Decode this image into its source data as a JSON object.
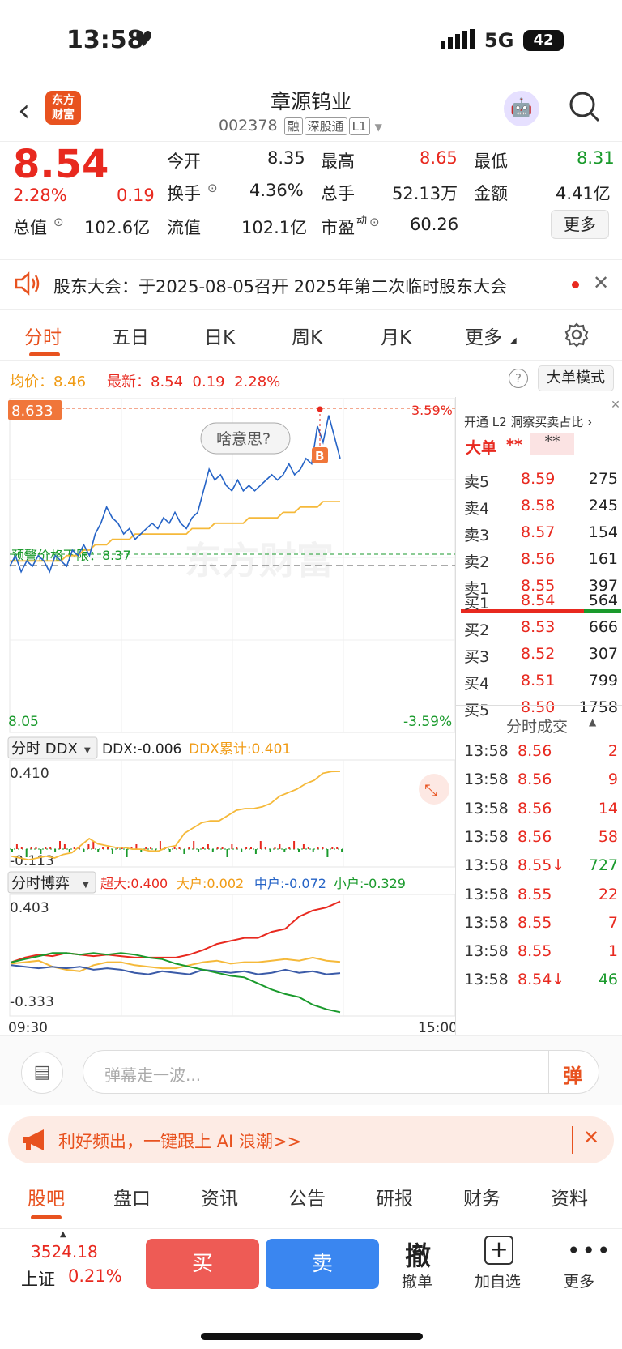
{
  "status": {
    "time": "13:58",
    "network": "5G",
    "battery": "42"
  },
  "header": {
    "logo": "东方财富",
    "logo_line1": "东方",
    "logo_line2": "财富",
    "title": "章源钨业",
    "code": "002378",
    "tags": [
      "融",
      "深股通",
      "L1"
    ]
  },
  "quote": {
    "price": "8.54",
    "change_pct": "2.28%",
    "change": "0.19",
    "open_label": "今开",
    "open": "8.35",
    "high_label": "最高",
    "high": "8.65",
    "low_label": "最低",
    "low": "8.31",
    "turnover_label": "换手",
    "turnover": "4.36%",
    "volume_label": "总手",
    "volume": "52.13万",
    "amount_label": "金额",
    "amount": "4.41亿",
    "mktcap_label": "总值",
    "mktcap": "102.6亿",
    "float_label": "流值",
    "float": "102.1亿",
    "pe_label": "市盈",
    "pe_sup": "动",
    "pe": "60.26",
    "more": "更多"
  },
  "notice": {
    "text": "股东大会：于2025-08-05召开 2025年第二次临时股东大会"
  },
  "tabs": [
    "分时",
    "五日",
    "日K",
    "周K",
    "月K",
    "更多"
  ],
  "infobar": {
    "avg_label": "均价：",
    "avg": "8.46",
    "latest_label": "最新：",
    "latest": "8.54",
    "change": "0.19",
    "pct": "2.28%",
    "big_order_mode": "大单模式"
  },
  "chart_data": [
    {
      "type": "line",
      "title": "",
      "y_top": "8.633",
      "y_bottom": "8.05",
      "pct_top": "3.59%",
      "pct_bottom": "-3.59%",
      "ylim": [
        8.05,
        8.633
      ],
      "limit_label": "预警价格下限：8.37",
      "watermark": "东方财富",
      "tooltip": "啥意思?",
      "marker": "B",
      "x_start": "09:30",
      "x_end": "15:00",
      "series": [
        {
          "values": [
            8.34,
            8.36,
            8.33,
            8.35,
            8.34,
            8.36,
            8.35,
            8.33,
            8.36,
            8.35,
            8.34,
            8.37,
            8.36,
            8.38,
            8.36,
            8.4,
            8.42,
            8.45,
            8.43,
            8.42,
            8.4,
            8.41,
            8.39,
            8.4,
            8.41,
            8.42,
            8.41,
            8.43,
            8.42,
            8.44,
            8.42,
            8.41,
            8.43,
            8.44,
            8.48,
            8.52,
            8.5,
            8.51,
            8.49,
            8.48,
            8.5,
            8.48,
            8.49,
            8.48,
            8.49,
            8.5,
            8.51,
            8.5,
            8.51,
            8.53,
            8.51,
            8.52,
            8.54,
            8.53,
            8.6,
            8.57,
            8.62,
            8.58,
            8.54
          ]
        },
        {
          "values": [
            8.35,
            8.35,
            8.35,
            8.35,
            8.35,
            8.35,
            8.35,
            8.35,
            8.35,
            8.35,
            8.36,
            8.36,
            8.36,
            8.37,
            8.37,
            8.38,
            8.38,
            8.38,
            8.39,
            8.39,
            8.39,
            8.39,
            8.4,
            8.4,
            8.4,
            8.4,
            8.4,
            8.4,
            8.4,
            8.4,
            8.4,
            8.4,
            8.41,
            8.41,
            8.41,
            8.41,
            8.42,
            8.42,
            8.42,
            8.42,
            8.42,
            8.42,
            8.43,
            8.43,
            8.43,
            8.43,
            8.43,
            8.43,
            8.44,
            8.44,
            8.44,
            8.45,
            8.45,
            8.45,
            8.45,
            8.46,
            8.46,
            8.46,
            8.46
          ]
        }
      ]
    },
    {
      "type": "line",
      "title": "分时 DDX",
      "ddx_label": "DDX:-0.006",
      "ddx_sum_label": "DDX累计:0.401",
      "y_top": "0.410",
      "y_bottom": "-0.113",
      "ylim": [
        -0.113,
        0.41
      ],
      "series": [
        {
          "values": [
            -0.08,
            -0.09,
            -0.1,
            -0.09,
            -0.08,
            -0.09,
            -0.07,
            -0.06,
            -0.02,
            0.02,
            -0.01,
            -0.02,
            -0.03,
            -0.03,
            -0.04,
            -0.04,
            -0.05,
            -0.05,
            -0.03,
            -0.02,
            0.05,
            0.08,
            0.11,
            0.12,
            0.12,
            0.15,
            0.18,
            0.19,
            0.19,
            0.2,
            0.22,
            0.26,
            0.28,
            0.3,
            0.33,
            0.35,
            0.39,
            0.4,
            0.401
          ]
        }
      ]
    },
    {
      "type": "line",
      "title": "分时博弈",
      "labels": [
        "超大:0.400",
        "大户:0.002",
        "中户:-0.072",
        "小户:-0.329"
      ],
      "y_top": "0.403",
      "y_bottom": "-0.333",
      "ylim": [
        -0.333,
        0.403
      ],
      "series": [
        {
          "values": [
            0.0,
            0.03,
            0.05,
            0.04,
            0.06,
            0.05,
            0.04,
            0.05,
            0.04,
            0.03,
            0.03,
            0.03,
            0.03,
            0.05,
            0.08,
            0.12,
            0.14,
            0.16,
            0.16,
            0.2,
            0.22,
            0.3,
            0.34,
            0.36,
            0.4
          ]
        },
        {
          "values": [
            -0.01,
            0.0,
            0.01,
            -0.03,
            -0.05,
            -0.06,
            -0.02,
            0.0,
            0.0,
            -0.02,
            -0.03,
            -0.04,
            -0.04,
            -0.02,
            0.0,
            0.01,
            -0.01,
            0.0,
            0.0,
            0.01,
            0.02,
            0.01,
            0.03,
            0.01,
            0.002
          ]
        },
        {
          "values": [
            -0.02,
            -0.03,
            -0.04,
            -0.03,
            -0.04,
            -0.03,
            -0.05,
            -0.04,
            -0.05,
            -0.07,
            -0.08,
            -0.06,
            -0.07,
            -0.08,
            -0.05,
            -0.06,
            -0.07,
            -0.06,
            -0.08,
            -0.07,
            -0.05,
            -0.07,
            -0.06,
            -0.08,
            -0.072
          ]
        },
        {
          "values": [
            0.0,
            0.02,
            0.04,
            0.06,
            0.06,
            0.05,
            0.06,
            0.05,
            0.06,
            0.05,
            0.03,
            0.02,
            -0.01,
            -0.03,
            -0.05,
            -0.07,
            -0.09,
            -0.1,
            -0.14,
            -0.18,
            -0.21,
            -0.23,
            -0.28,
            -0.31,
            -0.329
          ]
        }
      ]
    }
  ],
  "orderbook": {
    "promo": "开通 L2 洞察买卖占比 ›",
    "big_label": "大单",
    "big_val1": "**",
    "big_val2": "**",
    "asks": [
      [
        "卖5",
        "8.59",
        "275"
      ],
      [
        "卖4",
        "8.58",
        "245"
      ],
      [
        "卖3",
        "8.57",
        "154"
      ],
      [
        "卖2",
        "8.56",
        "161"
      ],
      [
        "卖1",
        "8.55",
        "397"
      ]
    ],
    "bids": [
      [
        "买1",
        "8.54",
        "564"
      ],
      [
        "买2",
        "8.53",
        "666"
      ],
      [
        "买3",
        "8.52",
        "307"
      ],
      [
        "买4",
        "8.51",
        "799"
      ],
      [
        "买5",
        "8.50",
        "1758"
      ]
    ],
    "ticks_title": "分时成交",
    "ticks": [
      [
        "13:58",
        "8.56",
        "2",
        "red"
      ],
      [
        "13:58",
        "8.56",
        "9",
        "red"
      ],
      [
        "13:58",
        "8.56",
        "14",
        "red"
      ],
      [
        "13:58",
        "8.56",
        "58",
        "red"
      ],
      [
        "13:58",
        "8.55↓",
        "727",
        "green"
      ],
      [
        "13:58",
        "8.55",
        "22",
        "red"
      ],
      [
        "13:58",
        "8.55",
        "7",
        "red"
      ],
      [
        "13:58",
        "8.55",
        "1",
        "red"
      ],
      [
        "13:58",
        "8.54↓",
        "46",
        "green"
      ]
    ]
  },
  "comment": {
    "placeholder": "弹幕走一波...",
    "danmu": "弹"
  },
  "promo": {
    "text": "利好频出，一键跟上 AI 浪潮>>"
  },
  "newstabs": [
    "股吧",
    "盘口",
    "资讯",
    "公告",
    "研报",
    "财务",
    "资料"
  ],
  "bottom": {
    "index_value": "3524.18",
    "index_name": "上证",
    "index_pct": "0.21%",
    "buy": "买",
    "sell": "卖",
    "cancel_glyph": "撤",
    "cancel": "撤单",
    "add": "加自选",
    "more": "更多"
  },
  "colors": {
    "red": "#e8291f",
    "green": "#1a9a2c",
    "blue": "#2563c6",
    "orange": "#f5b93a",
    "brand": "#e8521f"
  }
}
